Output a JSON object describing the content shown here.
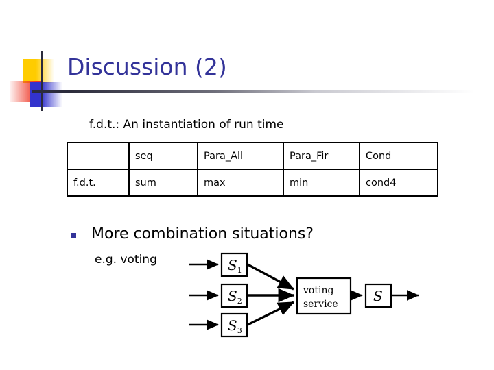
{
  "slide": {
    "title": "Discussion (2)",
    "title_color": "#333399",
    "background": "#ffffff",
    "subtitle": "f.d.t.: An instantiation of run time"
  },
  "logo": {
    "yellow": "#FFCC00",
    "red": "#EE3322",
    "blue": "#3333CC",
    "rule": "#2b2b3b"
  },
  "table": {
    "headers": [
      "",
      "seq",
      "Para_All",
      "Para_Fir",
      "Cond"
    ],
    "rows": [
      [
        "f.d.t.",
        "sum",
        "max",
        "min",
        "cond4"
      ]
    ]
  },
  "bullet": {
    "marker_color": "#333399",
    "text": "More combination situations?",
    "example_label": "e.g. voting"
  },
  "diagram": {
    "type": "flow",
    "inputs": [
      {
        "label": "S",
        "subscript": "1"
      },
      {
        "label": "S",
        "subscript": "2"
      },
      {
        "label": "S",
        "subscript": "3"
      }
    ],
    "service": {
      "line1": "voting",
      "line2": "service"
    },
    "output": {
      "label": "S",
      "subscript": ""
    }
  }
}
